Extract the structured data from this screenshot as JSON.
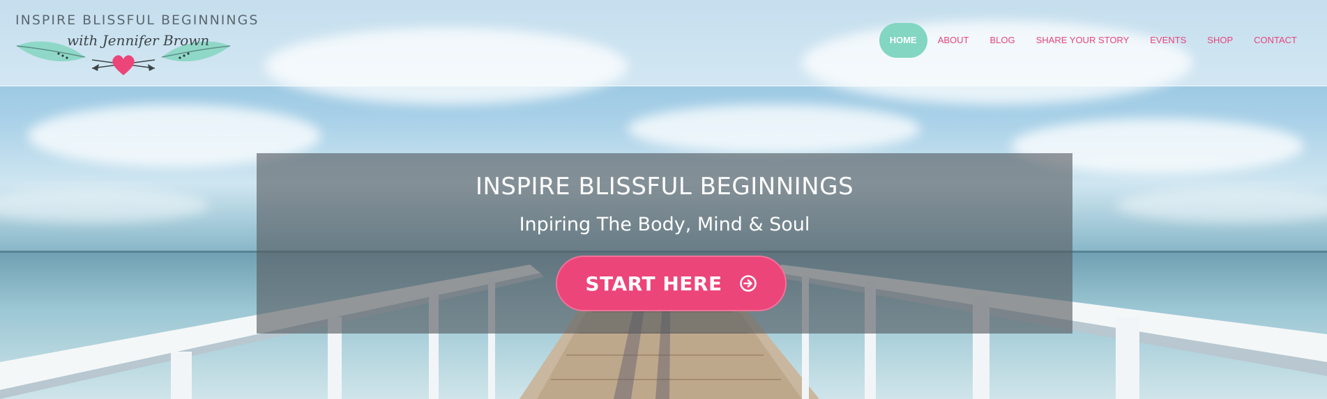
{
  "logo": {
    "title": "INSPIRE BLISSFUL BEGINNINGS",
    "subtitle": "with Jennifer Brown"
  },
  "nav": {
    "items": [
      {
        "label": "HOME",
        "active": true
      },
      {
        "label": "ABOUT",
        "active": false
      },
      {
        "label": "BLOG",
        "active": false
      },
      {
        "label": "SHARE YOUR STORY",
        "active": false
      },
      {
        "label": "EVENTS",
        "active": false
      },
      {
        "label": "SHOP",
        "active": false
      },
      {
        "label": "CONTACT",
        "active": false
      }
    ]
  },
  "hero": {
    "title": "INSPIRE BLISSFUL BEGINNINGS",
    "subtitle": "Inpiring The Body, Mind & Soul",
    "cta_label": "START HERE",
    "cta_icon": "arrow-right-circle-icon"
  },
  "colors": {
    "accent_pink": "#ec4579",
    "nav_text": "#e8437c",
    "nav_active_bg": "#82d6c2",
    "logo_feather": "#8fd8c8",
    "logo_heart": "#ec4579"
  }
}
